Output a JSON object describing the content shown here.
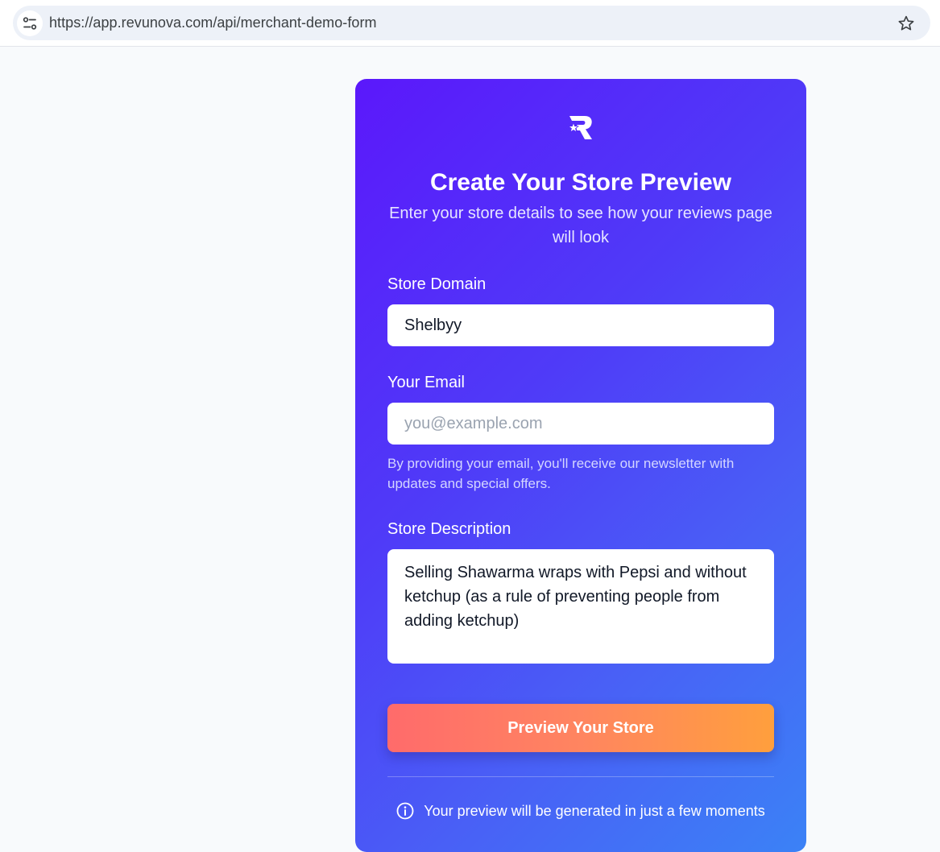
{
  "browser": {
    "url": "https://app.revunova.com/api/merchant-demo-form",
    "site_info_icon": "tune-icon",
    "bookmark_icon": "star-outline-icon"
  },
  "form": {
    "logo_icon": "revunova-star-r-logo",
    "title": "Create Your Store Preview",
    "subtitle": "Enter your store details to see how your reviews page will look",
    "domain": {
      "label": "Store Domain",
      "value": "Shelbyy"
    },
    "email": {
      "label": "Your Email",
      "value": "",
      "placeholder": "you@example.com",
      "helper": "By providing your email, you'll receive our newsletter with updates and special offers."
    },
    "description": {
      "label": "Store Description",
      "value": "Selling Shawarma wraps with Pepsi and without ketchup (as a rule of preventing people from adding ketchup)"
    },
    "submit_label": "Preview Your Store",
    "notice": "Your preview will be generated in just a few moments",
    "notice_icon": "info-circle-icon"
  },
  "colors": {
    "card_gradient_start": "#5b18fb",
    "card_gradient_end": "#3b82f6",
    "button_gradient_start": "#ff6b6b",
    "button_gradient_end": "#ff9f3d"
  }
}
